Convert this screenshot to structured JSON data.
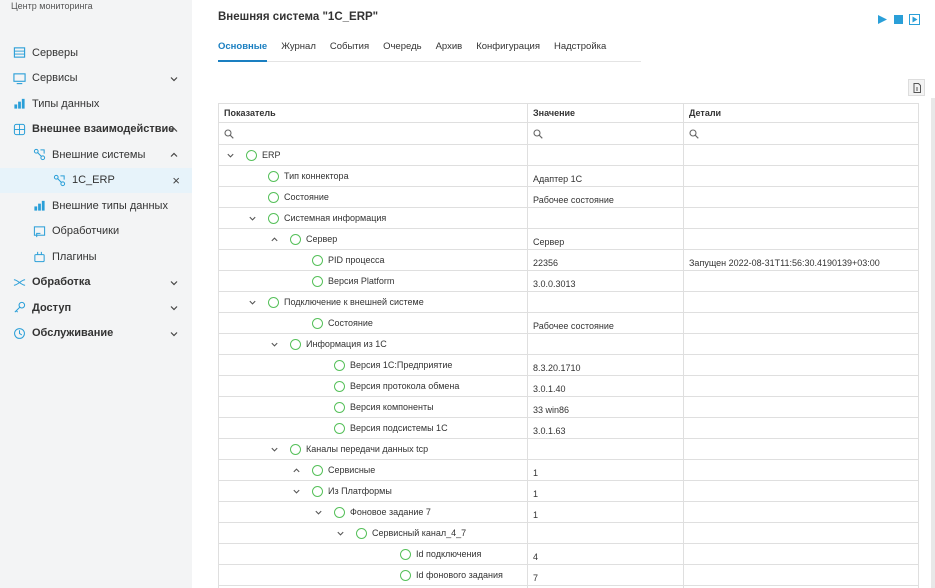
{
  "app": {
    "title": "Центр мониторинга"
  },
  "sidebar": {
    "items": [
      {
        "label": "Серверы"
      },
      {
        "label": "Сервисы"
      },
      {
        "label": "Типы данных"
      },
      {
        "label": "Внешнее взаимодействие"
      },
      {
        "label": "Внешние системы"
      },
      {
        "label": "1C_ERP"
      },
      {
        "label": "Внешние типы данных"
      },
      {
        "label": "Обработчики"
      },
      {
        "label": "Плагины"
      },
      {
        "label": "Обработка"
      },
      {
        "label": "Доступ"
      },
      {
        "label": "Обслуживание"
      }
    ]
  },
  "page": {
    "title": "Внешняя система \"1C_ERP\""
  },
  "tabs": [
    {
      "label": "Основные"
    },
    {
      "label": "Журнал"
    },
    {
      "label": "События"
    },
    {
      "label": "Очередь"
    },
    {
      "label": "Архив"
    },
    {
      "label": "Конфигурация"
    },
    {
      "label": "Надстройка"
    }
  ],
  "table": {
    "headers": [
      "Показатель",
      "Значение",
      "Детали"
    ],
    "rows": [
      {
        "name": "ERP",
        "value": "",
        "details": ""
      },
      {
        "name": "Тип коннектора",
        "value": "Адаптер 1С",
        "details": ""
      },
      {
        "name": "Состояние",
        "value": "Рабочее состояние",
        "details": ""
      },
      {
        "name": "Системная информация",
        "value": "",
        "details": ""
      },
      {
        "name": "Сервер",
        "value": "Сервер",
        "details": ""
      },
      {
        "name": "PID процесса",
        "value": "22356",
        "details": "Запущен 2022-08-31T11:56:30.4190139+03:00"
      },
      {
        "name": "Версия Platform",
        "value": "3.0.0.3013",
        "details": ""
      },
      {
        "name": "Подключение к внешней системе",
        "value": "",
        "details": ""
      },
      {
        "name": "Состояние",
        "value": "Рабочее состояние",
        "details": ""
      },
      {
        "name": "Информация из 1С",
        "value": "",
        "details": ""
      },
      {
        "name": "Версия 1С:Предприятие",
        "value": "8.3.20.1710",
        "details": ""
      },
      {
        "name": "Версия протокола обмена",
        "value": "3.0.1.40",
        "details": ""
      },
      {
        "name": "Версия компоненты",
        "value": "33 win86",
        "details": ""
      },
      {
        "name": "Версия подсистемы 1С",
        "value": "3.0.1.63",
        "details": ""
      },
      {
        "name": "Каналы передачи данных tcp",
        "value": "",
        "details": ""
      },
      {
        "name": "Сервисные",
        "value": "1",
        "details": ""
      },
      {
        "name": "Из Платформы",
        "value": "1",
        "details": ""
      },
      {
        "name": "Фоновое задание 7",
        "value": "1",
        "details": ""
      },
      {
        "name": "Сервисный канал_4_7",
        "value": "",
        "details": ""
      },
      {
        "name": "Id подключения",
        "value": "4",
        "details": ""
      },
      {
        "name": "Id фонового задания",
        "value": "7",
        "details": ""
      },
      {
        "name": "",
        "value": "",
        "details": ""
      }
    ]
  },
  "colors": {
    "accent": "#1a7fc1",
    "status_ok": "#56c05a",
    "icon": "#2a9fd8"
  }
}
